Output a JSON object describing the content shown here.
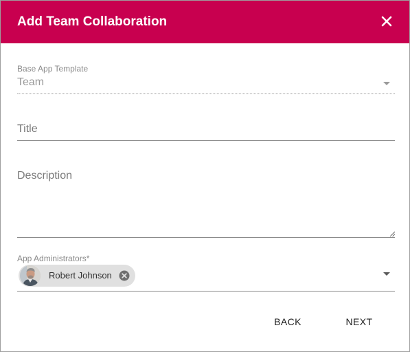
{
  "dialog": {
    "title": "Add Team Collaboration",
    "accent_color": "#c8004f"
  },
  "fields": {
    "base_template": {
      "label": "Base App Template",
      "value": "Team"
    },
    "title": {
      "placeholder": "Title"
    },
    "description": {
      "placeholder": "Description"
    },
    "administrators": {
      "label": "App Administrators*",
      "selected": [
        {
          "name": "Robert Johnson"
        }
      ]
    }
  },
  "actions": {
    "back_label": "BACK",
    "next_label": "NEXT"
  },
  "icons": {
    "close": "close-icon",
    "dropdown": "chevron-down-icon",
    "chip_remove": "remove-circle-icon"
  }
}
